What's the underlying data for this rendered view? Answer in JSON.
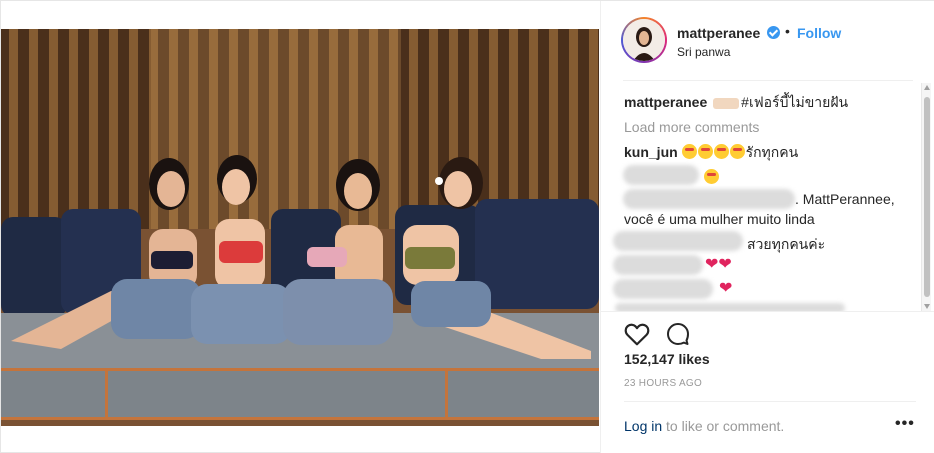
{
  "header": {
    "username": "mattperanee",
    "separator": "•",
    "follow_label": "Follow",
    "location": "Sri panwa"
  },
  "caption": {
    "username": "mattperanee",
    "text": "#เฟอร์บี้ไม่ขายฝัน"
  },
  "load_more": "Load more comments",
  "comments": [
    {
      "username": "kun_jun",
      "text": "รักทุกคน"
    },
    {
      "text_a": ". MattPerannee,",
      "text_b": "você é uma mulher muito linda"
    },
    {
      "text": "สวยทุกคนค่ะ"
    }
  ],
  "hearts": "❤❤",
  "heart_single": "❤",
  "likes": "152,147 likes",
  "time": "23 HOURS AGO",
  "footer": {
    "login_link": "Log in",
    "login_rest": " to like or comment.",
    "more": "•••"
  },
  "colors": {
    "link_blue": "#3897f0",
    "muted": "#999999",
    "text": "#262626",
    "heart": "#e0245e"
  },
  "icons": {
    "verified": "verified-badge-icon",
    "like": "heart-outline-icon",
    "comment": "speech-bubble-icon",
    "more": "ellipsis-icon"
  }
}
